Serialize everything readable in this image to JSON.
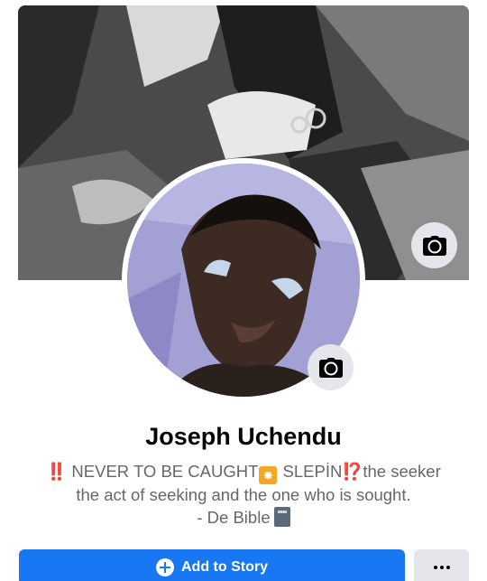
{
  "profile": {
    "name": "Joseph Uchendu",
    "bio": {
      "line1_bang": "‼️",
      "line1_text_a": " NEVER TO BE CAUGHT",
      "line1_burst": "✸",
      "line1_text_b": " SLEPİN",
      "line1_interrobang": "⁉️",
      "line1_text_c": "the seeker",
      "line2": "the act of seeking and the one who is sought.",
      "line3": "- De Bible"
    }
  },
  "icons": {
    "cover_camera": "camera-icon",
    "avatar_camera": "camera-icon",
    "add_story": "plus-circle-icon",
    "more": "ellipsis-icon",
    "bio_book": "notebook-icon"
  },
  "actions": {
    "add_story_label": "Add to Story"
  },
  "colors": {
    "primary": "#1877f2",
    "secondary_button": "#e4e6eb",
    "name_text": "#050505",
    "bio_text": "#65676b"
  }
}
